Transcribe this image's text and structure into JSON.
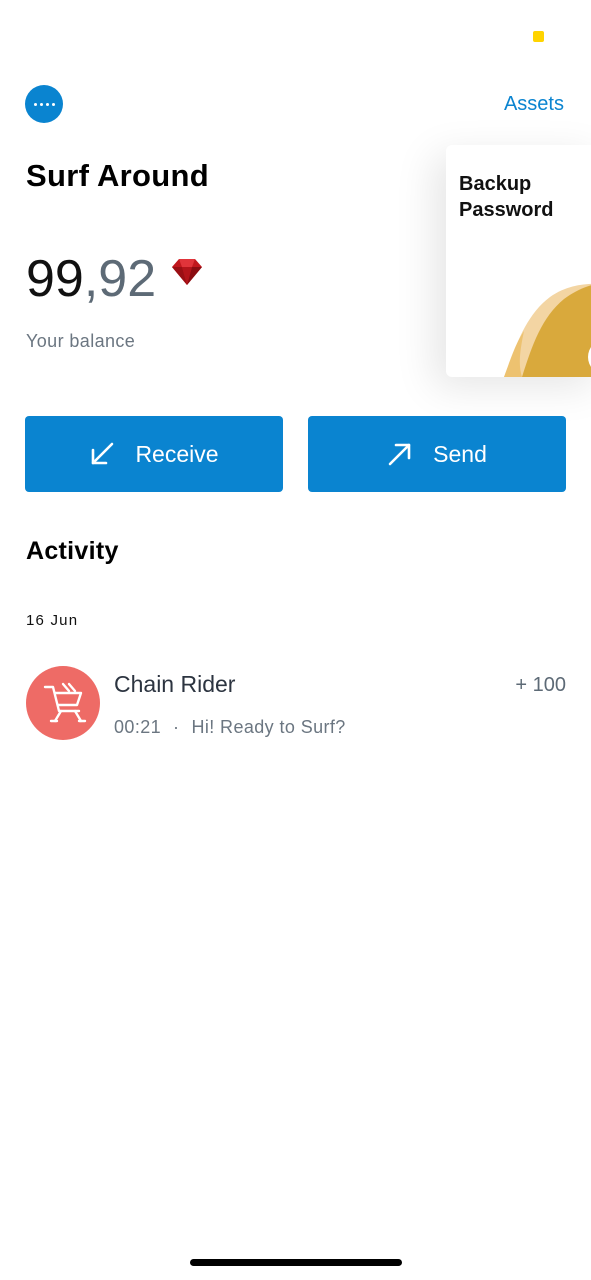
{
  "header": {
    "menu_icon": "more-horizontal-icon",
    "assets_label": "Assets"
  },
  "account": {
    "title": "Surf Around",
    "balance_integer": "99",
    "balance_decimal": ",92",
    "currency_icon": "ruby-gem-icon",
    "balance_label": "Your balance"
  },
  "backup_card": {
    "title": "Backup Password",
    "colors": {
      "gold": "#d9a93c",
      "peach": "#f3d5a3"
    }
  },
  "actions": {
    "receive_label": "Receive",
    "receive_icon": "arrow-down-left-icon",
    "send_label": "Send",
    "send_icon": "arrow-up-right-icon"
  },
  "activity": {
    "title": "Activity",
    "groups": [
      {
        "date": "16 Jun",
        "items": [
          {
            "name": "Chain Rider",
            "amount": "+ 100",
            "time": "00:21",
            "separator": "·",
            "message": "Hi! Ready to Surf?",
            "avatar_icon": "shopping-cart-icon",
            "avatar_color": "#ee6b66"
          }
        ]
      }
    ]
  },
  "colors": {
    "accent": "#0a84d0",
    "text_primary": "#111111",
    "text_secondary": "#6b7681",
    "ruby": "#c0171d",
    "status_dot": "#ffd400"
  }
}
